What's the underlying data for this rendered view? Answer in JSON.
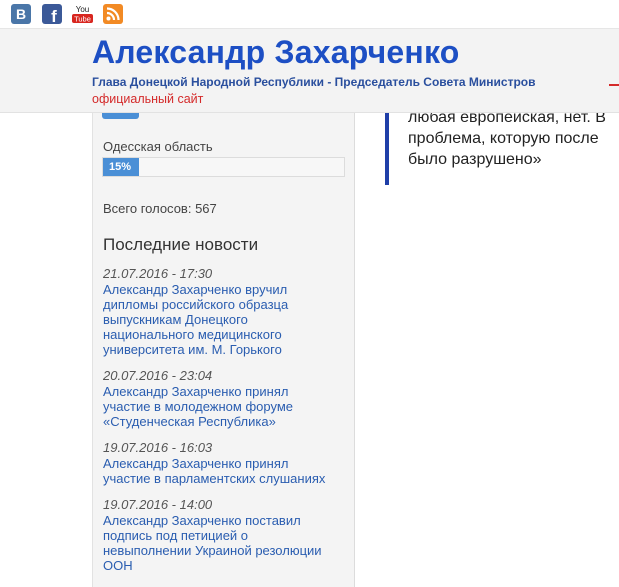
{
  "social": {
    "vk_letter": "B",
    "fb_letter": "f",
    "yt_you": "You",
    "yt_tube": "Tube",
    "icons": [
      "vk-icon",
      "facebook-icon",
      "youtube-icon",
      "rss-icon"
    ]
  },
  "header": {
    "title": "Александр Захарченко",
    "subtitle": "Глава Донецкой Народной Республики - Председатель Совета Министров",
    "tagline": "официальный сайт"
  },
  "poll": {
    "option_label": "Одесская область",
    "option_percent_text": "15%",
    "option_percent": 15,
    "total": "Всего голосов: 567"
  },
  "news": {
    "heading": "Последние новости",
    "items": [
      {
        "date": "21.07.2016 - 17:30",
        "title_lines": [
          "Александр Захарченко вручил",
          "дипломы российского образца",
          "выпускникам Донецкого",
          "национального медицинского",
          "университета им. М. Горького"
        ]
      },
      {
        "date": "20.07.2016 - 23:04",
        "title_lines": [
          "Александр Захарченко принял",
          "участие в молодежном форуме",
          "«Студенческая Республика»"
        ]
      },
      {
        "date": "19.07.2016 - 16:03",
        "title_lines": [
          "Александр Захарченко принял",
          "участие в парламентских слушаниях"
        ]
      },
      {
        "date": "19.07.2016 - 14:00",
        "title_lines": [
          "Александр Захарченко поставил",
          "подпись под петицией о",
          "невыполнении Украиной резолюции",
          "ООН"
        ]
      }
    ]
  },
  "quote": {
    "lines": [
      "любая европейская, нет. В",
      "проблема, которую после",
      "было разрушено»"
    ]
  },
  "colors": {
    "title": "#1d4fc4",
    "accent_red": "#d42a2a",
    "progress": "#4a8fd6",
    "link": "#2a5db0",
    "quote_bar": "#1f3fa8"
  }
}
